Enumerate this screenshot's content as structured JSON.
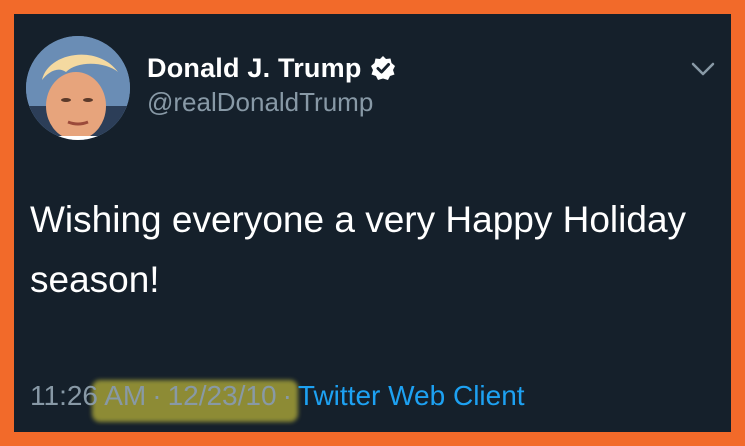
{
  "tweet": {
    "display_name": "Donald J. Trump",
    "handle": "@realDonaldTrump",
    "text": "Wishing everyone a very Happy Holiday season!",
    "time": "11:26 AM",
    "separator": "·",
    "date": "12/23/10",
    "client": "Twitter Web Client"
  },
  "icons": {
    "verified": "verified-badge-icon",
    "more": "chevron-down-icon"
  },
  "colors": {
    "frame": "#f26a2a",
    "background": "#15202b",
    "primary_text": "#ffffff",
    "secondary_text": "#8899a6",
    "link": "#1da1f2",
    "highlight": "#d6cd3c"
  }
}
